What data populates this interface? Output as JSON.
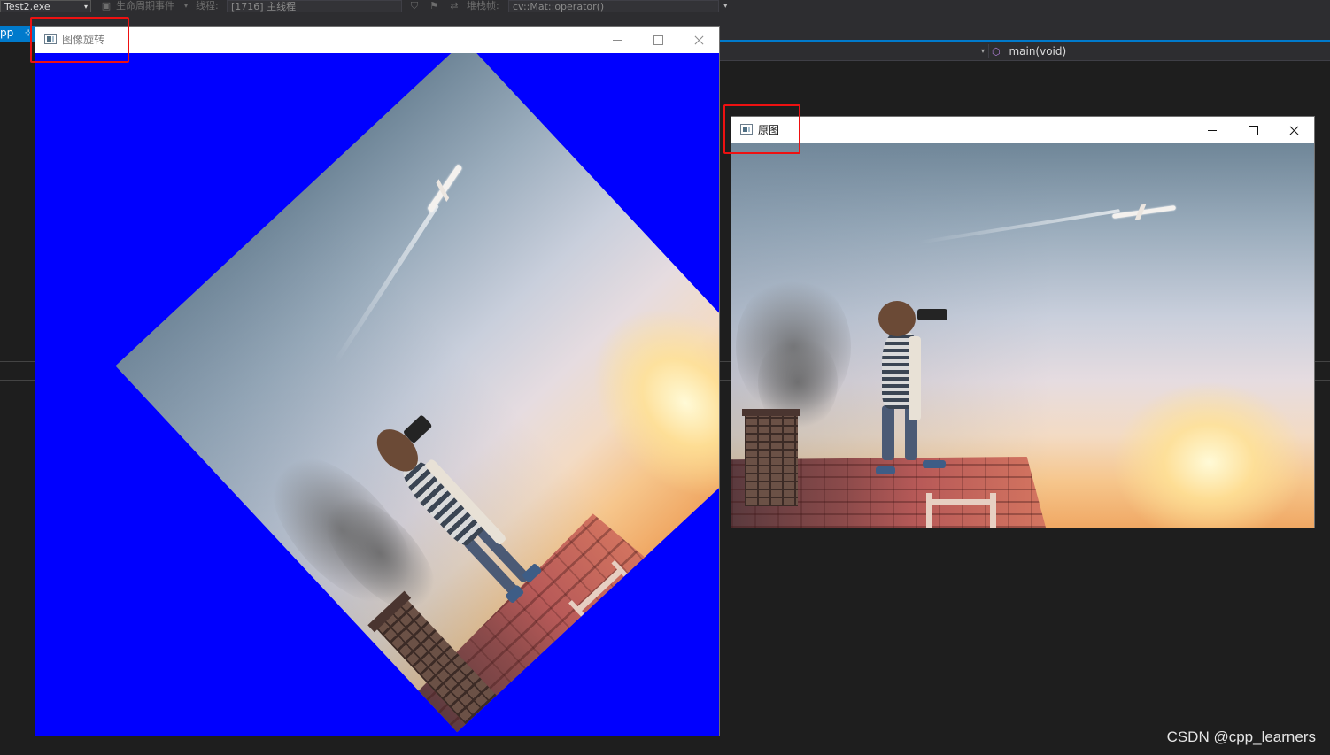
{
  "ide": {
    "toolbar": {
      "process": "Test2.exe",
      "lifecycle": "生命周期事件",
      "thread_label": "线程:",
      "thread": "[1716] 主线程",
      "stack_label": "堆栈帧:",
      "stack": "cv::Mat::operator()"
    },
    "tab": {
      "label": "pp"
    },
    "nav": {
      "function": "main(void)"
    },
    "accent_color": "#007acc",
    "watermark": "CSDN @cpp_learners"
  },
  "windows": [
    {
      "title": "图像旋转",
      "background_color": "#0000ff"
    },
    {
      "title": "原图"
    }
  ],
  "highlight_color": "#ee1111"
}
